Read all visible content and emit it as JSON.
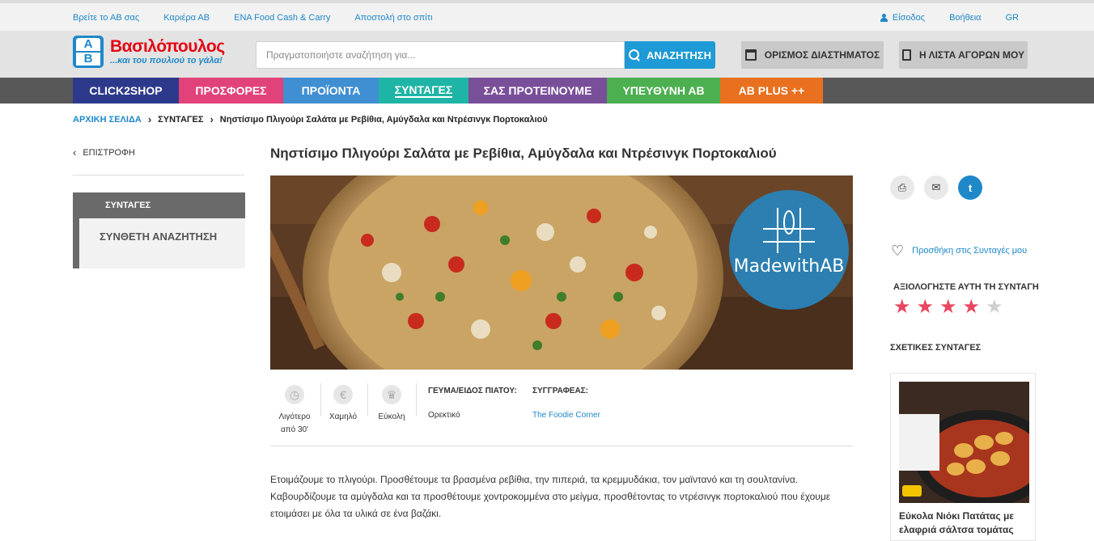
{
  "topbar": {
    "links": [
      "Βρείτε το ΑΒ σας",
      "Καριέρα ΑΒ",
      "ENA Food Cash & Carry",
      "Αποστολή στο σπίτι"
    ],
    "login": "Είσοδος",
    "help": "Βοήθεια",
    "lang": "GR"
  },
  "header": {
    "logo_name": "Βασιλόπουλος",
    "logo_slogan": "...και του πουλιού το γάλα!",
    "logo_letters": [
      "A",
      "B"
    ],
    "search_placeholder": "Πραγματοποιήστε αναζήτηση για...",
    "search_button": "ΑΝΑΖΗΤΗΣΗ",
    "slot_button": "ΟΡΙΣΜΟΣ ΔΙΑΣΤΗΜΑΤΟΣ",
    "list_button": "Η ΛΙΣΤΑ ΑΓΟΡΩΝ ΜΟΥ"
  },
  "nav": [
    {
      "label": "CLICK2SHOP",
      "color": "#2d3a8c"
    },
    {
      "label": "ΠΡΟΣΦΟΡΕΣ",
      "color": "#e2427a"
    },
    {
      "label": "ΠΡΟΪΟΝΤΑ",
      "color": "#3f8fd2"
    },
    {
      "label": "ΣΥΝΤΑΓΕΣ",
      "color": "#1fb5a6"
    },
    {
      "label": "ΣΑΣ ΠΡΟΤΕΙΝΟΥΜΕ",
      "color": "#7a4f9a"
    },
    {
      "label": "ΥΠΕΥΘΥΝΗ ΑΒ",
      "color": "#4caf50"
    },
    {
      "label": "AB PLUS ++",
      "color": "#e8701f"
    }
  ],
  "breadcrumb": {
    "home": "ΑΡΧΙΚΗ ΣΕΛΙΔΑ",
    "section": "ΣΥΝΤΑΓΕΣ",
    "current": "Νηστίσιμο Πλιγούρι Σαλάτα με Ρεβίθια, Αμύγδαλα και Ντρέσινγκ Πορτοκαλιού"
  },
  "sidebar": {
    "back": "ΕΠΙΣΤΡΟΦΗ",
    "heading": "ΣΥΝΤΑΓΕΣ",
    "sub": "ΣΥΝΘΕΤΗ ΑΝΑΖΗΤΗΣΗ"
  },
  "recipe": {
    "title": "Νηστίσιμο Πλιγούρι Σαλάτα με Ρεβίθια, Αμύγδαλα και Ντρέσινγκ Πορτοκαλιού",
    "badge": "MadewithAB",
    "time_line1": "Λιγότερο",
    "time_line2": "από 30'",
    "cost": "Χαμηλό",
    "difficulty": "Εύκολη",
    "meal_label": "ΓΕΥΜΑ/ΕΙΔΟΣ ΠΙΑΤΟΥ:",
    "meal_value": "Ορεκτικό",
    "author_label": "ΣΥΓΓΡΑΦΕΑΣ:",
    "author_value": "The Foodie Corner",
    "description": "Ετοιμάζουμε το πλιγούρι. Προσθέτουμε τα βρασμένα ρεβίθια, την πιπεριά, τα κρεμμυδάκια, τον μαϊντανό και τη σουλτανίνα. Καβουρδίζουμε τα αμύγδαλα και τα προσθέτουμε χοντροκομμένα στο μείγμα, προσθέτοντας το ντρέσινγκ πορτοκαλιού που έχουμε ετοιμάσει με όλα τα υλικά σε ένα βαζάκι."
  },
  "right": {
    "add_favorite": "Προσθήκη στις Συνταγές μου",
    "rate_title": "ΑΞΙΟΛΟΓΗΣΤΕ ΑΥΤΗ ΤΗ ΣΥΝΤΑΓΗ",
    "rating": 4,
    "rating_max": 5,
    "related_title": "ΣΧΕΤΙΚΕΣ ΣΥΝΤΑΓΕΣ",
    "related_item": "Εύκολα Νιόκι Πατάτας με ελαφριά σάλτσα τομάτας"
  },
  "colors": {
    "accent_blue": "#1e88c9",
    "star_on": "#e8475f",
    "star_off": "#d0d0d0"
  }
}
